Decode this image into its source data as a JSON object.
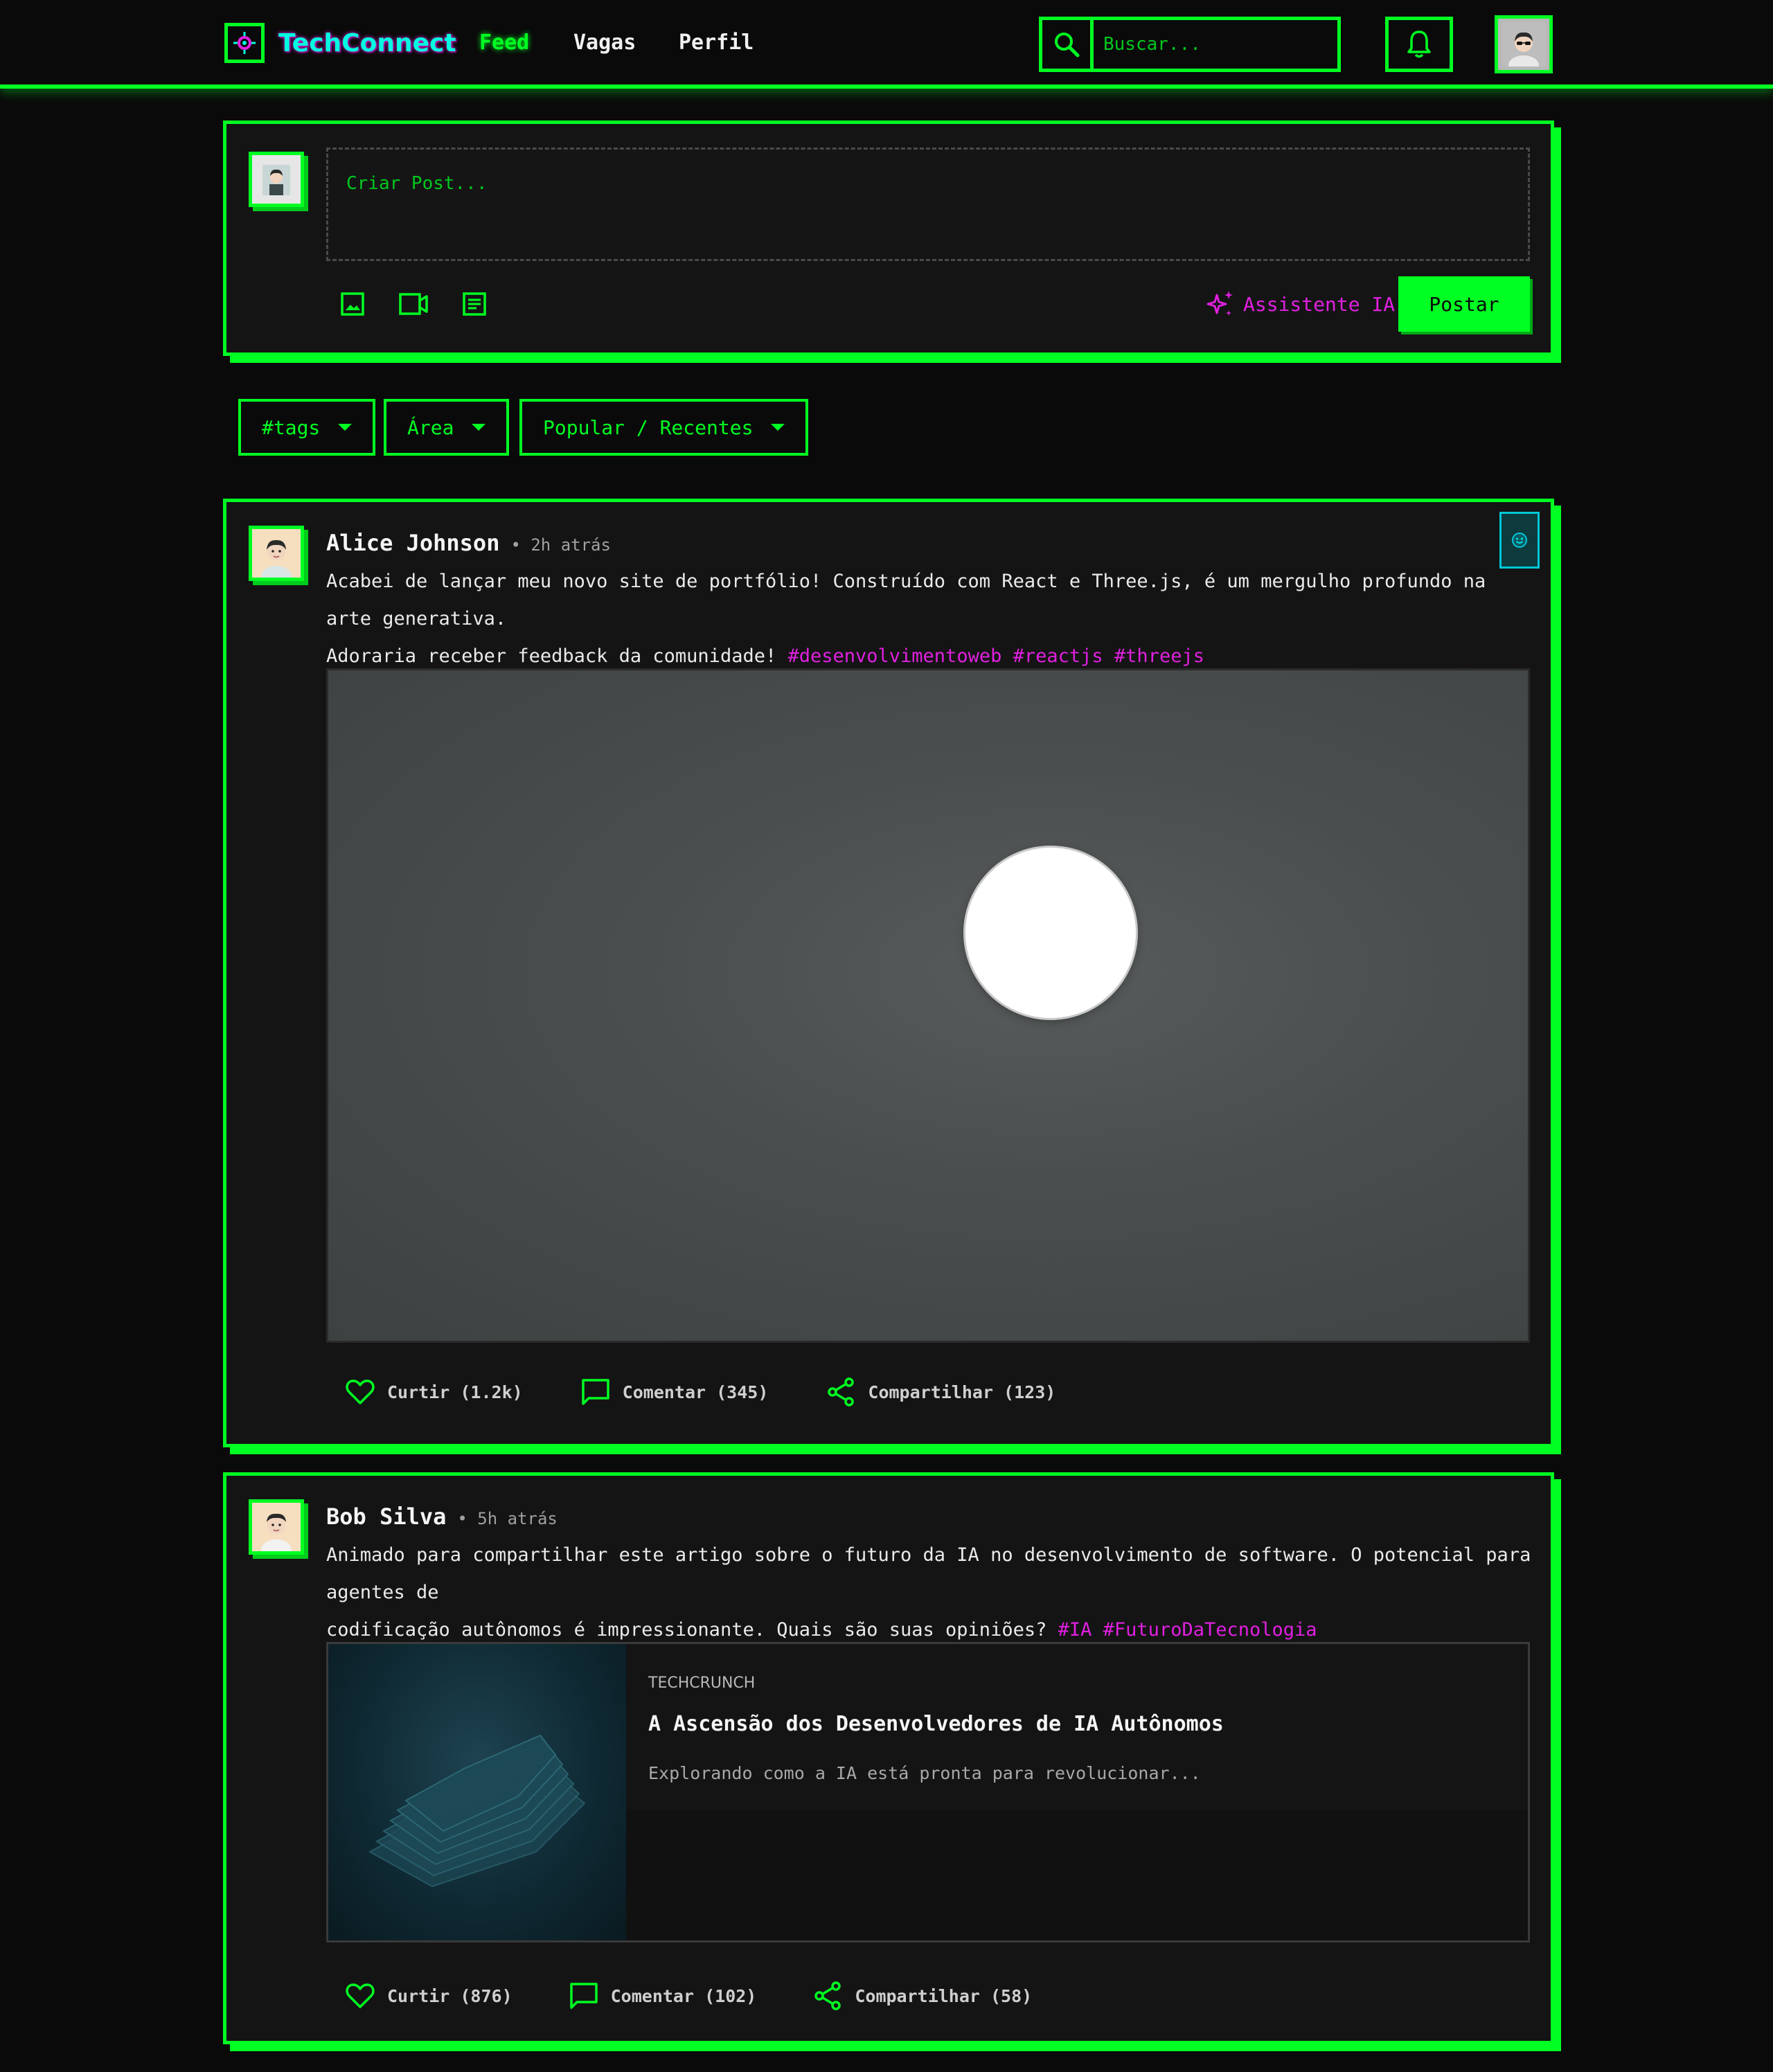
{
  "header": {
    "logo_text": "TechConnect",
    "nav": {
      "feed": "Feed",
      "jobs": "Vagas",
      "profile": "Perfil"
    },
    "search_placeholder": "Buscar..."
  },
  "composer": {
    "placeholder": "Criar Post...",
    "ai_assistant_label": "Assistente IA",
    "post_button": "Postar"
  },
  "filters": {
    "tags": "#tags",
    "area": "Área",
    "sort": "Popular / Recentes"
  },
  "posts": [
    {
      "author": "Alice Johnson",
      "time": "• 2h atrás",
      "text_line1": "Acabei de lançar meu novo site de portfólio! Construído com React e Three.js, é um mergulho profundo na arte generativa.",
      "text_line2": "Adoraria receber feedback da comunidade!",
      "tags": [
        "#desenvolvimentoweb",
        "#reactjs",
        "#threejs"
      ],
      "actions": {
        "like": "Curtir (1.2k)",
        "comment": "Comentar (345)",
        "share": "Compartilhar (123)"
      }
    },
    {
      "author": "Bob Silva",
      "time": "• 5h atrás",
      "text_line1": "Animado para compartilhar este artigo sobre o futuro da IA no desenvolvimento de software. O potencial para agentes de",
      "text_line2": "codificação autônomos é impressionante. Quais são suas opiniões?",
      "tags": [
        "#IA",
        "#FuturoDaTecnologia"
      ],
      "link": {
        "source": "TECHCRUNCH",
        "title": "A Ascensão dos Desenvolvedores de IA Autônomos",
        "description": "Explorando como a IA está pronta para revolucionar..."
      },
      "actions": {
        "like": "Curtir (876)",
        "comment": "Comentar (102)",
        "share": "Compartilhar (58)"
      }
    }
  ],
  "colors": {
    "accent": "#00ff22",
    "tag": "#e020e0",
    "background": "#0a0a0a",
    "card": "#141414"
  },
  "icons": [
    "logo-icon",
    "search-icon",
    "bell-icon",
    "image-icon",
    "video-icon",
    "article-icon",
    "sparkle-icon",
    "heart-icon",
    "comment-icon",
    "share-icon",
    "ai-badge-icon"
  ]
}
